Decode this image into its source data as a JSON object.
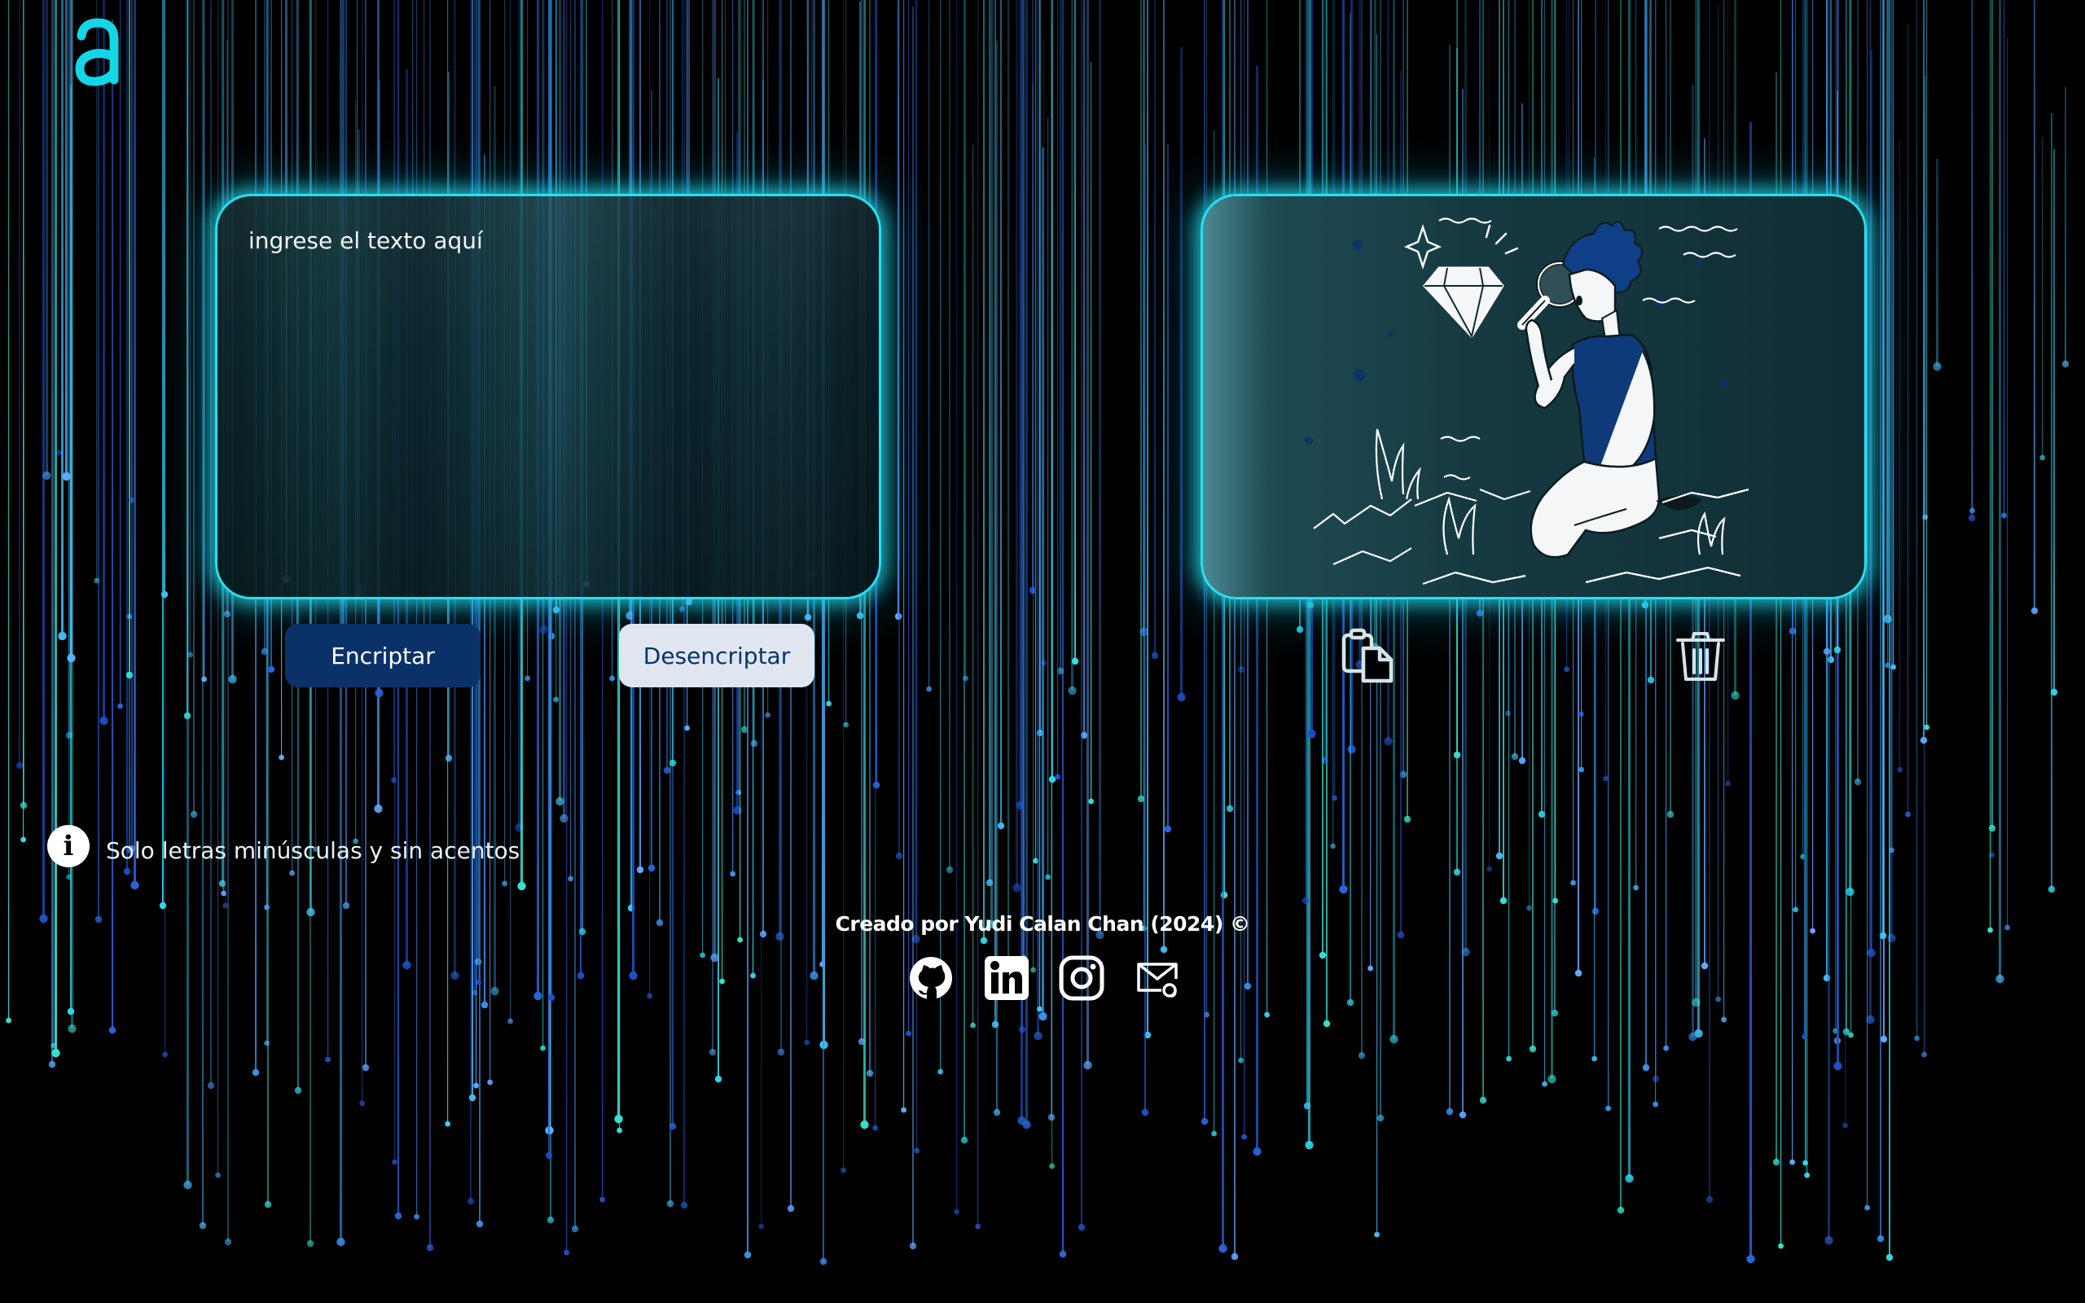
{
  "logo": {
    "glyph": "a",
    "color": "#13d6e6"
  },
  "input": {
    "placeholder": "ingrese el texto aquí",
    "value": ""
  },
  "buttons": {
    "encrypt_label": "Encriptar",
    "decrypt_label": "Desencriptar"
  },
  "tools": {
    "copy_icon": "clipboard-copy-icon",
    "trash_icon": "trash-icon"
  },
  "info": {
    "icon": "info-icon",
    "text": "Solo letras minúsculas y sin acentos"
  },
  "footer": {
    "credit": "Creado por Yudi Calan Chan (2024) ©",
    "socials": [
      "github-icon",
      "linkedin-icon",
      "instagram-icon",
      "email-icon"
    ]
  },
  "colors": {
    "accent": "#27e0f0",
    "button_primary": "#0a3269",
    "button_secondary": "#dfe6f0",
    "background": "#000000"
  }
}
